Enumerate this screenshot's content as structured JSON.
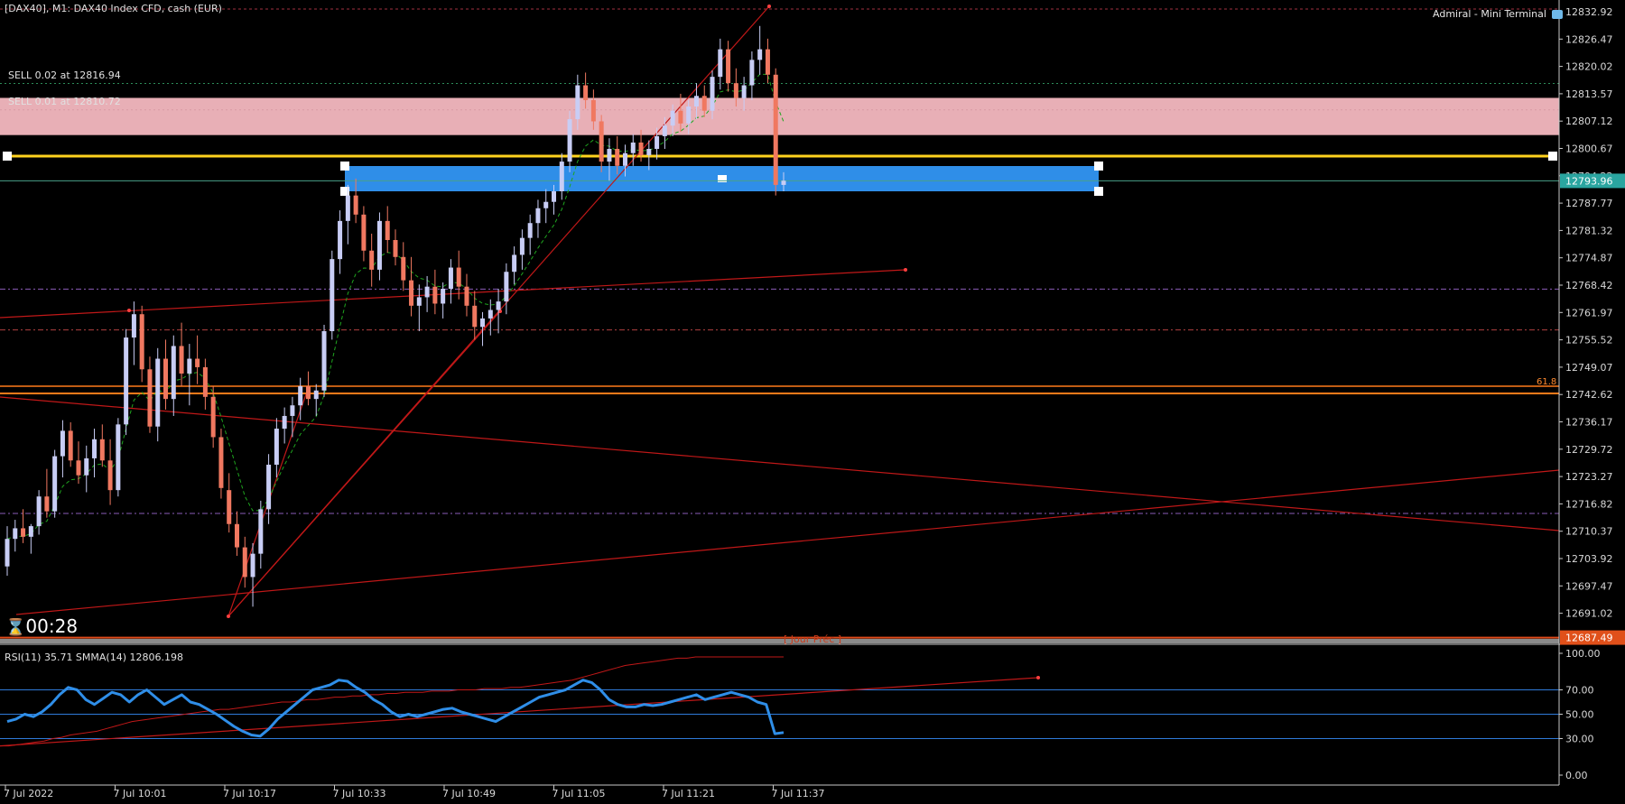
{
  "header": {
    "symbol_info": "[DAX40], M1:  DAX40 Index CFD, cash (EUR)",
    "terminal_label": "Admiral - Mini Terminal"
  },
  "orders": [
    {
      "label": "SELL 0.02 at 12816.94",
      "price": 12816.94
    },
    {
      "label": "SELL 0.01 at 12810.72",
      "price": 12810.72
    }
  ],
  "timer": "00:28",
  "price_axis": {
    "ticks": [
      "12832.92",
      "12826.47",
      "12820.02",
      "12813.57",
      "12807.12",
      "12800.67",
      "12794.22",
      "12787.77",
      "12781.32",
      "12774.87",
      "12768.42",
      "12761.97",
      "12755.52",
      "12749.07",
      "12742.62",
      "12736.17",
      "12729.72",
      "12723.27",
      "12716.82",
      "12710.37",
      "12703.92",
      "12697.47",
      "12691.02"
    ],
    "current_price": "12793.96",
    "prev_day_price": "12687.49"
  },
  "annotations": {
    "fib_label": "61.8",
    "prev_day_label": "[ Jour Préc ]"
  },
  "rsi_panel": {
    "label": "RSI(11) 35.71 SMMA(14) 12806.198",
    "ticks": [
      "100.00",
      "70.00",
      "50.00",
      "30.00",
      "0.00"
    ]
  },
  "time_axis": {
    "labels": [
      "7 Jul 2022",
      "7 Jul 10:01",
      "7 Jul 10:17",
      "7 Jul 10:33",
      "7 Jul 10:49",
      "7 Jul 11:05",
      "7 Jul 11:21",
      "7 Jul 11:37"
    ]
  },
  "colors": {
    "bull": "#c8cdf5",
    "bear": "#f07860",
    "sell_zone": "#f4b8c0",
    "box": "#2f8ee8",
    "yellow_line": "#ffd21e",
    "orange_line": "#ff7a1a",
    "red_line": "#c01818",
    "rsi_line": "#2f8ee8",
    "ma_line": "#1fa51f"
  },
  "chart_data": {
    "type": "candlestick",
    "symbol": "[DAX40]",
    "timeframe": "M1",
    "price_range": [
      12686,
      12836
    ],
    "rsi_range": [
      0,
      100
    ],
    "rsi_levels": [
      70,
      50,
      30
    ],
    "levels": {
      "sell_orders": [
        12816.94,
        12810.72
      ],
      "yellow_level": 12799.8,
      "current_price": 12793.96,
      "fib_618": 12743.8,
      "prev_day": 12687.49
    },
    "candles": [
      [
        12703.0,
        12712.5,
        12700.8,
        12709.5
      ],
      [
        12709.5,
        12714.0,
        12706.5,
        12712.0
      ],
      [
        12712.0,
        12716.5,
        12708.5,
        12710.0
      ],
      [
        12710.0,
        12713.0,
        12706.0,
        12712.5
      ],
      [
        12712.5,
        12721.0,
        12710.5,
        12719.5
      ],
      [
        12719.5,
        12726.0,
        12714.5,
        12716.0
      ],
      [
        12716.0,
        12730.5,
        12714.5,
        12729.0
      ],
      [
        12729.0,
        12737.5,
        12724.0,
        12735.0
      ],
      [
        12735.0,
        12737.0,
        12726.5,
        12728.0
      ],
      [
        12728.0,
        12732.5,
        12722.5,
        12724.5
      ],
      [
        12724.5,
        12731.5,
        12720.5,
        12728.5
      ],
      [
        12728.5,
        12735.5,
        12724.0,
        12733.0
      ],
      [
        12733.0,
        12736.5,
        12726.5,
        12728.0
      ],
      [
        12728.0,
        12733.0,
        12717.5,
        12721.0
      ],
      [
        12721.0,
        12738.0,
        12719.5,
        12736.5
      ],
      [
        12736.5,
        12759.0,
        12734.0,
        12757.0
      ],
      [
        12757.0,
        12765.5,
        12750.5,
        12762.5
      ],
      [
        12762.5,
        12764.5,
        12746.5,
        12749.5
      ],
      [
        12749.5,
        12752.5,
        12734.5,
        12736.0
      ],
      [
        12736.0,
        12754.5,
        12732.5,
        12752.0
      ],
      [
        12752.0,
        12756.5,
        12740.0,
        12742.5
      ],
      [
        12742.5,
        12757.5,
        12738.5,
        12755.0
      ],
      [
        12755.0,
        12760.5,
        12745.5,
        12748.5
      ],
      [
        12748.5,
        12755.5,
        12741.0,
        12752.0
      ],
      [
        12752.0,
        12757.5,
        12746.0,
        12750.0
      ],
      [
        12750.0,
        12752.0,
        12740.0,
        12743.0
      ],
      [
        12743.0,
        12745.5,
        12731.0,
        12733.5
      ],
      [
        12733.5,
        12735.5,
        12719.0,
        12721.5
      ],
      [
        12721.0,
        12725.0,
        12711.0,
        12713.0
      ],
      [
        12713.0,
        12716.0,
        12705.5,
        12707.5
      ],
      [
        12707.5,
        12710.0,
        12698.0,
        12700.5
      ],
      [
        12700.5,
        12708.5,
        12693.5,
        12706.0
      ],
      [
        12706.0,
        12718.5,
        12702.5,
        12716.5
      ],
      [
        12716.5,
        12729.5,
        12713.0,
        12727.0
      ],
      [
        12727.0,
        12738.0,
        12724.0,
        12735.5
      ],
      [
        12735.5,
        12740.5,
        12732.0,
        12738.5
      ],
      [
        12738.5,
        12743.0,
        12733.5,
        12741.0
      ],
      [
        12741.0,
        12747.5,
        12737.5,
        12745.5
      ],
      [
        12745.5,
        12749.0,
        12741.0,
        12742.5
      ],
      [
        12742.5,
        12746.0,
        12738.5,
        12744.5
      ],
      [
        12744.5,
        12760.0,
        12743.0,
        12758.5
      ],
      [
        12758.5,
        12777.5,
        12756.5,
        12775.5
      ],
      [
        12775.5,
        12787.0,
        12772.0,
        12784.5
      ],
      [
        12784.5,
        12793.0,
        12779.0,
        12790.5
      ],
      [
        12790.5,
        12794.5,
        12784.0,
        12786.0
      ],
      [
        12786.0,
        12788.0,
        12775.0,
        12777.5
      ],
      [
        12777.5,
        12781.5,
        12769.0,
        12773.0
      ],
      [
        12773.0,
        12786.5,
        12770.5,
        12784.5
      ],
      [
        12784.5,
        12788.0,
        12777.0,
        12780.0
      ],
      [
        12780.0,
        12782.5,
        12774.0,
        12776.0
      ],
      [
        12776.0,
        12779.5,
        12768.0,
        12770.5
      ],
      [
        12770.5,
        12776.0,
        12762.0,
        12764.5
      ],
      [
        12764.5,
        12769.5,
        12758.5,
        12766.5
      ],
      [
        12766.5,
        12771.5,
        12763.0,
        12769.0
      ],
      [
        12769.0,
        12773.0,
        12762.5,
        12765.0
      ],
      [
        12765.0,
        12770.0,
        12761.5,
        12768.5
      ],
      [
        12768.5,
        12775.5,
        12765.0,
        12773.5
      ],
      [
        12773.5,
        12777.5,
        12766.0,
        12769.0
      ],
      [
        12769.0,
        12772.0,
        12762.0,
        12764.5
      ],
      [
        12764.5,
        12768.0,
        12756.5,
        12759.5
      ],
      [
        12759.5,
        12763.0,
        12755.0,
        12761.5
      ],
      [
        12761.5,
        12766.0,
        12757.5,
        12763.5
      ],
      [
        12763.5,
        12768.5,
        12758.0,
        12765.5
      ],
      [
        12765.5,
        12774.5,
        12762.5,
        12772.5
      ],
      [
        12772.5,
        12778.5,
        12769.5,
        12776.5
      ],
      [
        12776.5,
        12782.5,
        12773.0,
        12780.5
      ],
      [
        12780.5,
        12786.0,
        12776.5,
        12784.0
      ],
      [
        12784.0,
        12789.5,
        12780.5,
        12787.5
      ],
      [
        12787.5,
        12792.0,
        12784.0,
        12789.0
      ],
      [
        12789.0,
        12793.0,
        12786.0,
        12791.5
      ],
      [
        12791.5,
        12800.5,
        12789.5,
        12798.5
      ],
      [
        12798.5,
        12810.5,
        12796.0,
        12808.5
      ],
      [
        12808.5,
        12819.0,
        12806.0,
        12816.5
      ],
      [
        12816.5,
        12819.5,
        12811.0,
        12813.0
      ],
      [
        12813.0,
        12815.5,
        12806.0,
        12808.0
      ],
      [
        12808.0,
        12809.5,
        12796.0,
        12798.5
      ],
      [
        12798.5,
        12804.0,
        12794.0,
        12801.5
      ],
      [
        12801.5,
        12804.5,
        12795.5,
        12797.5
      ],
      [
        12797.5,
        12802.5,
        12795.0,
        12800.5
      ],
      [
        12800.5,
        12805.0,
        12797.5,
        12803.0
      ],
      [
        12803.0,
        12806.0,
        12798.5,
        12800.0
      ],
      [
        12800.0,
        12803.5,
        12796.5,
        12801.5
      ],
      [
        12801.5,
        12806.5,
        12799.0,
        12804.5
      ],
      [
        12804.5,
        12809.0,
        12801.5,
        12807.0
      ],
      [
        12807.0,
        12812.0,
        12804.5,
        12810.5
      ],
      [
        12810.5,
        12814.5,
        12805.5,
        12807.5
      ],
      [
        12807.5,
        12813.0,
        12805.0,
        12811.5
      ],
      [
        12811.5,
        12817.0,
        12808.5,
        12814.0
      ],
      [
        12814.0,
        12816.5,
        12809.0,
        12810.5
      ],
      [
        12810.5,
        12820.0,
        12808.5,
        12818.5
      ],
      [
        12818.5,
        12827.5,
        12815.5,
        12825.0
      ],
      [
        12825.0,
        12827.0,
        12815.0,
        12817.0
      ],
      [
        12817.0,
        12820.5,
        12811.5,
        12813.5
      ],
      [
        12813.5,
        12818.5,
        12810.5,
        12816.5
      ],
      [
        12816.5,
        12824.5,
        12813.0,
        12822.5
      ],
      [
        12822.5,
        12830.5,
        12819.0,
        12825.0
      ],
      [
        12825.0,
        12827.5,
        12817.0,
        12819.0
      ],
      [
        12819.0,
        12820.5,
        12790.5,
        12793.0
      ],
      [
        12793.0,
        12796.0,
        12791.5,
        12794.0
      ]
    ],
    "rsi": [
      44,
      46,
      50,
      48,
      52,
      58,
      66,
      72,
      70,
      62,
      58,
      63,
      68,
      66,
      60,
      66,
      70,
      64,
      58,
      62,
      66,
      60,
      58,
      54,
      50,
      45,
      40,
      36,
      33,
      32,
      38,
      46,
      52,
      58,
      64,
      70,
      72,
      74,
      78,
      77,
      72,
      68,
      62,
      58,
      52,
      48,
      50,
      48,
      50,
      52,
      54,
      55,
      52,
      50,
      48,
      46,
      44,
      48,
      52,
      56,
      60,
      64,
      66,
      68,
      70,
      74,
      78,
      76,
      70,
      62,
      58,
      56,
      56,
      58,
      57,
      58,
      60,
      62,
      64,
      66,
      62,
      64,
      66,
      68,
      66,
      64,
      60,
      58,
      34,
      35
    ],
    "rsi_ma": [
      24,
      24,
      25,
      26,
      27,
      28,
      30,
      31,
      33,
      34,
      35,
      36,
      38,
      40,
      42,
      44,
      45,
      46,
      47,
      48,
      49,
      50,
      51,
      52,
      53,
      54,
      54,
      55,
      56,
      57,
      58,
      59,
      60,
      60,
      61,
      62,
      62,
      63,
      64,
      64,
      65,
      65,
      66,
      66,
      67,
      67,
      68,
      68,
      68,
      69,
      69,
      69,
      70,
      70,
      70,
      71,
      71,
      71,
      72,
      72,
      73,
      74,
      75,
      76,
      77,
      78,
      80,
      82,
      84,
      86,
      88,
      90,
      91,
      92,
      93,
      94,
      95,
      96,
      96,
      97,
      97,
      97,
      97,
      97,
      97,
      97,
      97,
      97,
      97,
      97
    ]
  }
}
